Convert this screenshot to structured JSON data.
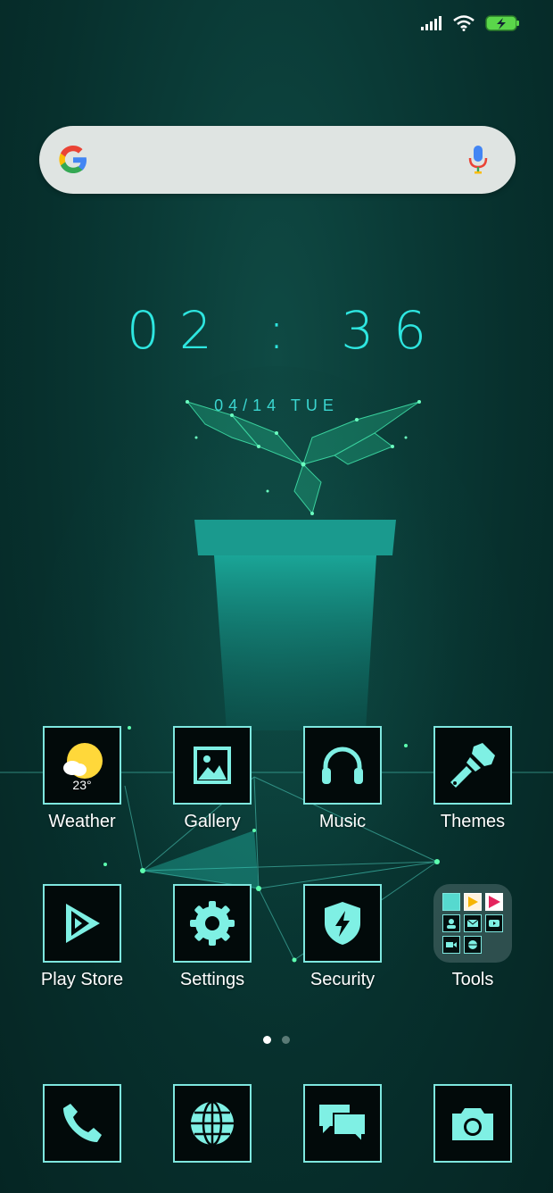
{
  "status_bar": {
    "icons": [
      "signal-icon",
      "wifi-icon",
      "battery-charging-icon"
    ]
  },
  "search": {
    "icons": [
      "google-g-icon",
      "microphone-icon"
    ]
  },
  "clock": {
    "time": "02 : 36",
    "date": "04/14  TUE"
  },
  "apps": [
    {
      "label": "Weather",
      "icon": "weather-sun-icon",
      "temp": "23°"
    },
    {
      "label": "Gallery",
      "icon": "image-icon"
    },
    {
      "label": "Music",
      "icon": "headphones-icon"
    },
    {
      "label": "Themes",
      "icon": "paintbrush-icon"
    },
    {
      "label": "Play Store",
      "icon": "play-icon"
    },
    {
      "label": "Settings",
      "icon": "gear-icon"
    },
    {
      "label": "Security",
      "icon": "shield-bolt-icon"
    },
    {
      "label": "Tools",
      "icon": "folder-icon"
    }
  ],
  "page_indicator": {
    "total": 2,
    "active": 1
  },
  "dock": [
    {
      "icon": "phone-icon"
    },
    {
      "icon": "globe-icon"
    },
    {
      "icon": "chat-icon"
    },
    {
      "icon": "camera-icon"
    }
  ],
  "colors": {
    "accent": "#2ee6e0",
    "tile_border": "#7ee7df",
    "icon_fill": "#7ff0e4"
  }
}
